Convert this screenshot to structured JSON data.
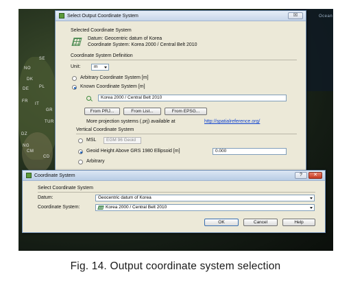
{
  "background_map": {
    "labels": [
      "SE",
      "NO",
      "DK",
      "PL",
      "DE",
      "FR",
      "IT",
      "GR",
      "TUR",
      "DZ",
      "NG",
      "CM",
      "CD",
      "Ocean"
    ]
  },
  "output_dialog": {
    "title": "Select Output Coordinate System",
    "close_label": "☒",
    "selected_heading": "Selected Coordinate System",
    "datum_line": "Datum: Geocentric datum of Korea",
    "cs_line": "Coordinate System: Korea 2000 / Central Belt 2010",
    "definition_heading": "Coordinate System Definition",
    "unit_label": "Unit:",
    "unit_value": "m",
    "arbitrary_cs_label": "Arbitrary Coordinate System [m]",
    "known_cs_label": "Known Coordinate System [m]",
    "known_cs_value": "Korea 2000 / Central Belt 2010",
    "buttons": [
      "From PRJ...",
      "From List...",
      "From EPSG..."
    ],
    "more_text": "More projection systems (.prj) available at",
    "more_link": "http://spatialreference.org/",
    "vertical_heading": "Vertical Coordinate System",
    "msl_label": "MSL",
    "msl_value": "EGM 96 Geoid",
    "geoid_label": "Geoid Height Above GRS 1980 Ellipsoid [m]",
    "geoid_value": "0.000",
    "arbitrary_label": "Arbitrary"
  },
  "cs_dialog": {
    "title": "Coordinate System",
    "help_label": "?",
    "close_label": "✕",
    "heading": "Select Coordinate System",
    "datum_label": "Datum:",
    "datum_value": "Geocentric datum of Korea",
    "cs_label": "Coordinate System:",
    "cs_value": "Korea 2000 / Central Belt 2010",
    "ok_label": "OK",
    "cancel_label": "Cancel",
    "help_button_label": "Help"
  },
  "caption": "Fig. 14. Output coordinate system selection"
}
